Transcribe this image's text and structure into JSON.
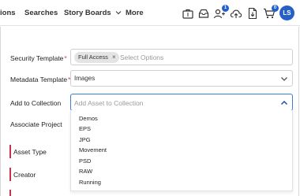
{
  "nav": {
    "items": [
      "ions",
      "Searches",
      "Story Boards",
      "More"
    ],
    "more_chevron": "chevron-down-icon",
    "icons": [
      "briefcase-icon",
      "inbox-icon",
      "users-icon",
      "upload-cloud-icon",
      "document-download-icon",
      "cart-icon"
    ],
    "badges": {
      "users": "1",
      "cart": "0"
    },
    "avatar_initials": "LS"
  },
  "form": {
    "security_template": {
      "label": "Security Template",
      "required": "*",
      "chip": "Full Access",
      "chip_remove": "×",
      "placeholder": "Select Options"
    },
    "metadata_template": {
      "label": "Metadata Template",
      "required": "*",
      "value": "Images"
    },
    "add_to_collection": {
      "label": "Add to Collection",
      "placeholder": "Add Asset to Collection"
    },
    "associate_project": {
      "label": "Associate Project"
    },
    "asset_type": {
      "label": "Asset Type"
    },
    "creator": {
      "label": "Creator"
    }
  },
  "dropdown_options": [
    "Demos",
    "EPS",
    "JPG",
    "Movement",
    "PSD",
    "RAW",
    "Running"
  ],
  "colors": {
    "accent": "#1f5fd1",
    "avatar": "#2660c6",
    "focus_border": "#3a7be0",
    "required_bar": "#c8324a"
  }
}
